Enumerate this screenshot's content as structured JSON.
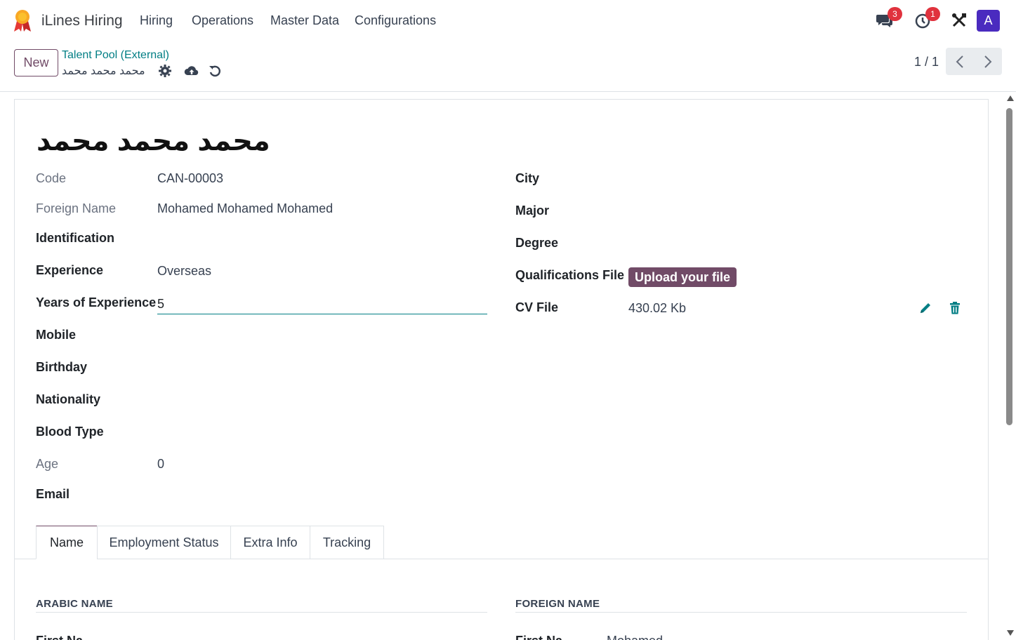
{
  "nav": {
    "app_name": "iLines Hiring",
    "menu": [
      "Hiring",
      "Operations",
      "Master Data",
      "Configurations"
    ],
    "messages_count": "3",
    "activities_count": "1",
    "avatar_letter": "A"
  },
  "control_panel": {
    "new_label": "New",
    "breadcrumb_parent": "Talent Pool (External)",
    "breadcrumb_current": "محمد محمد محمد",
    "pager": "1 / 1"
  },
  "record": {
    "title": "محمد محمد محمد",
    "left_fields": {
      "code_label": "Code",
      "code_value": "CAN-00003",
      "foreign_name_label": "Foreign Name",
      "foreign_name_value": "Mohamed Mohamed Mohamed",
      "identification_label": "Identification",
      "experience_label": "Experience",
      "experience_value": "Overseas",
      "years_label": "Years of Experience",
      "years_value": "5",
      "mobile_label": "Mobile",
      "birthday_label": "Birthday",
      "nationality_label": "Nationality",
      "blood_type_label": "Blood Type",
      "age_label": "Age",
      "age_value": "0",
      "email_label": "Email"
    },
    "right_fields": {
      "city_label": "City",
      "major_label": "Major",
      "degree_label": "Degree",
      "qualifications_label": "Qualifications File",
      "upload_label": "Upload your file",
      "cv_label": "CV File",
      "cv_value": "430.02 Kb"
    }
  },
  "tabs": [
    "Name",
    "Employment Status",
    "Extra Info",
    "Tracking"
  ],
  "name_tab": {
    "arabic_heading": "ARABIC NAME",
    "foreign_heading": "FOREIGN NAME",
    "first_name_label_partial": "First Na",
    "foreign_first_label_partial": "First Na",
    "foreign_first_value_partial": "Mohamed"
  },
  "colors": {
    "brand": "#714b67",
    "link": "#017e84",
    "badge": "#e0323d",
    "avatar": "#4a2bbf"
  }
}
